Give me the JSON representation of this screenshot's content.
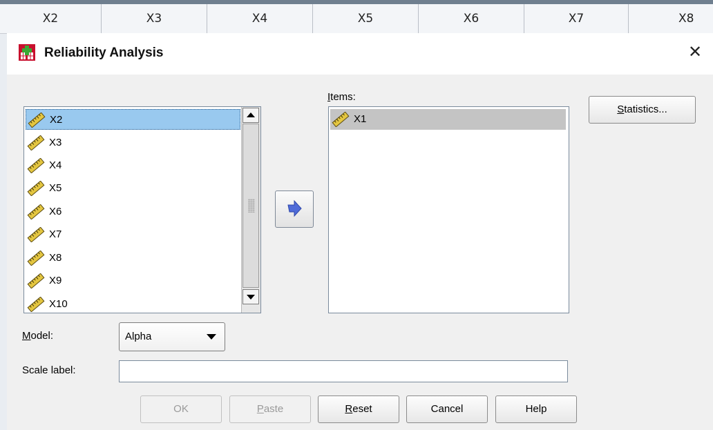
{
  "spreadsheet": {
    "columns": [
      "X2",
      "X3",
      "X4",
      "X5",
      "X6",
      "X7",
      "X8"
    ]
  },
  "dialog": {
    "title": "Reliability Analysis",
    "close_glyph": "✕",
    "source_list": {
      "items": [
        {
          "label": "X2",
          "icon": "scale-ruler-icon",
          "selected": true
        },
        {
          "label": "X3",
          "icon": "scale-ruler-icon"
        },
        {
          "label": "X4",
          "icon": "scale-ruler-icon"
        },
        {
          "label": "X5",
          "icon": "scale-ruler-icon"
        },
        {
          "label": "X6",
          "icon": "scale-ruler-icon"
        },
        {
          "label": "X7",
          "icon": "scale-ruler-icon"
        },
        {
          "label": "X8",
          "icon": "scale-ruler-icon"
        },
        {
          "label": "X9",
          "icon": "scale-ruler-icon"
        },
        {
          "label": "X10",
          "icon": "scale-ruler-icon"
        }
      ]
    },
    "move_button_icon": "right-arrow-icon",
    "items_box": {
      "label_mnemonic": "I",
      "label_rest": "tems:",
      "items": [
        {
          "label": "X1",
          "icon": "scale-ruler-icon",
          "selected": true
        }
      ]
    },
    "statistics_button": {
      "mnemonic": "S",
      "rest": "tatistics..."
    },
    "model": {
      "label_mnemonic": "M",
      "label_rest": "odel:",
      "selected": "Alpha"
    },
    "scale_label": {
      "label": "Scale label:",
      "value": ""
    },
    "buttons": {
      "ok": "OK",
      "paste_mnemonic": "P",
      "paste_rest": "aste",
      "reset_mnemonic": "R",
      "reset_rest": "eset",
      "cancel": "Cancel",
      "help": "Help"
    }
  },
  "colors": {
    "selection_blue": "#99c9ef",
    "selection_gray": "#c4c4c4",
    "arrow_blue": "#4f6bd8",
    "icon_red": "#c8102e",
    "icon_green": "#3aa935"
  }
}
